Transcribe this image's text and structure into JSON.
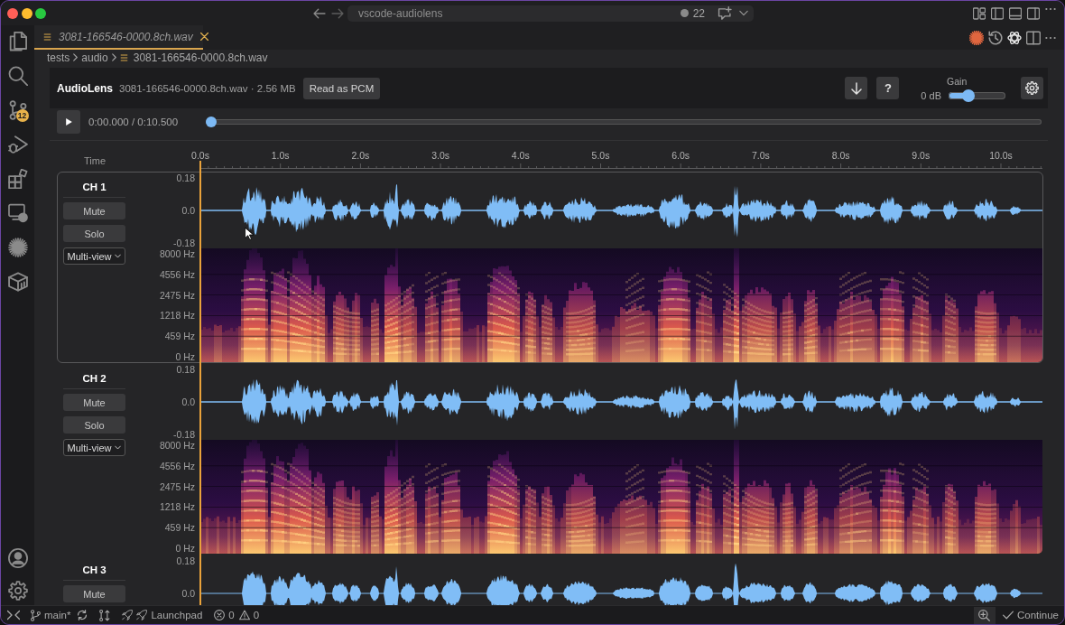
{
  "window": {
    "title": "vscode-audiolens",
    "counter": "22"
  },
  "activity_bar": {
    "badge": "12"
  },
  "tabs": [
    {
      "label": "3081-166546-0000.8ch.wav",
      "selected": true,
      "preview": true
    }
  ],
  "breadcrumbs": [
    "tests",
    "audio",
    "3081-166546-0000.8ch.wav"
  ],
  "header": {
    "title": "AudioLens",
    "file_info": "3081-166546-0000.8ch.wav · 2.56 MB",
    "read_button": "Read as PCM",
    "help_button": "?",
    "gain": {
      "label": "Gain",
      "reading": "0 dB",
      "level": 0.35
    }
  },
  "transport": {
    "time": "0:00.000 / 0:10.500",
    "seek": {
      "level": 0
    }
  },
  "time_axis": {
    "label": "Time",
    "ticks": [
      "0.0s",
      "1.0s",
      "2.0s",
      "3.0s",
      "4.0s",
      "5.0s",
      "6.0s",
      "7.0s",
      "8.0s",
      "9.0s",
      "10.0s"
    ]
  },
  "channels": [
    {
      "name": "CH 1",
      "selected": true,
      "mute_button": "Mute",
      "solo_button": "Solo",
      "view": "Multi-view",
      "amplitude_ticks": [
        "0.18",
        "0.0",
        "-0.18"
      ],
      "frequency_ticks": [
        "8000 Hz",
        "4556 Hz",
        "2475 Hz",
        "1218 Hz",
        "459 Hz",
        "0 Hz"
      ]
    },
    {
      "name": "CH 2",
      "selected": false,
      "mute_button": "Mute",
      "solo_button": "Solo",
      "view": "Multi-view",
      "amplitude_ticks": [
        "0.18",
        "0.0",
        "-0.18"
      ],
      "frequency_ticks": [
        "8000 Hz",
        "4556 Hz",
        "2475 Hz",
        "1218 Hz",
        "459 Hz",
        "0 Hz"
      ]
    },
    {
      "name": "CH 3",
      "selected": false,
      "mute_button": "Mute",
      "amplitude_ticks": [
        "0.18",
        "0.0"
      ]
    }
  ],
  "status_bar": {
    "branch": "main*",
    "launchpad": "Launchpad",
    "errors": "0",
    "warnings": "0",
    "continue_button": "Continue"
  }
}
